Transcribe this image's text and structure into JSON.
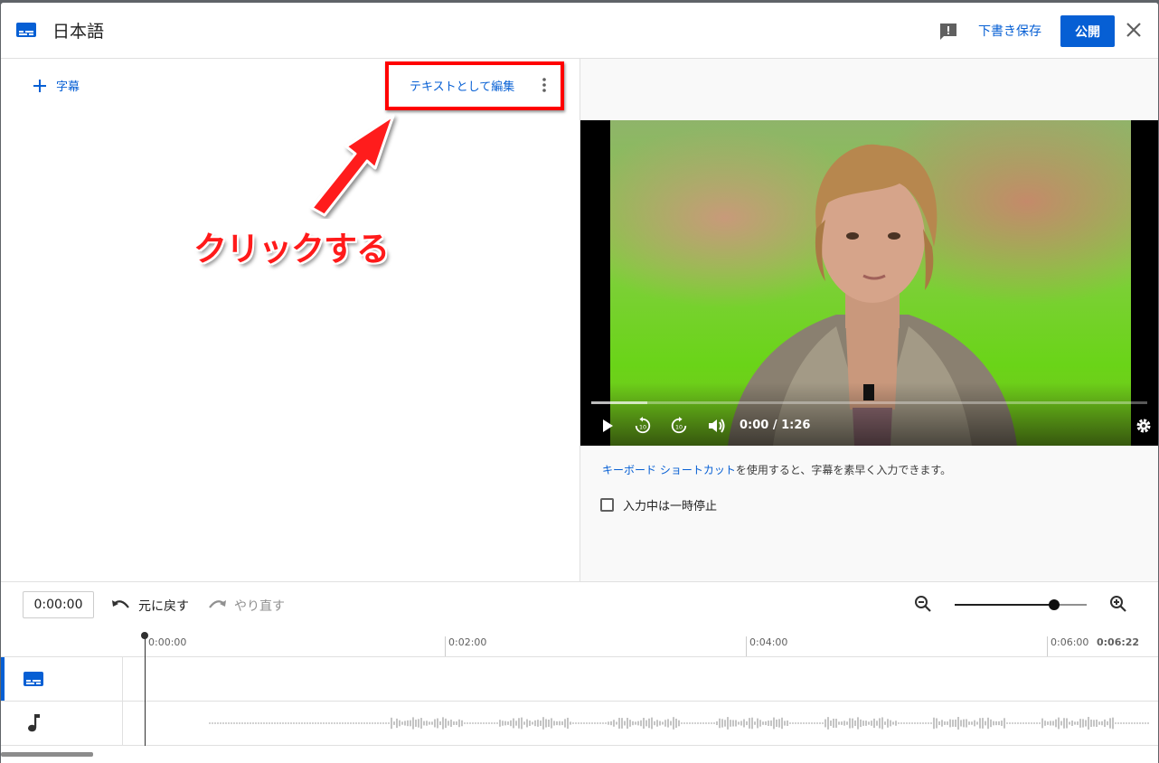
{
  "header": {
    "title": "日本語",
    "draft_label": "下書き保存",
    "publish_label": "公開",
    "icons": [
      "subtitles-icon",
      "feedback-icon",
      "close-icon"
    ]
  },
  "editor": {
    "add_subtitle_label": "字幕",
    "edit_as_text_label": "テキストとして編集",
    "annotation": "クリックする"
  },
  "player": {
    "time": "0:00 / 1:26",
    "progress": 0.1
  },
  "hints": {
    "keyboard_link": "キーボード ショートカット",
    "keyboard_text": "を使用すると、字幕を素早く入力できます。",
    "pause_label": "入力中は一時停止",
    "pause_checked": false
  },
  "timeline": {
    "current_time": "0:00:00",
    "undo_label": "元に戻す",
    "redo_label": "やり直す",
    "zoom_level": 0.75,
    "ticks": [
      "0:00:00",
      "0:02:00",
      "0:04:00",
      "0:06:00"
    ],
    "end_time": "0:06:22"
  },
  "colors": {
    "accent": "#065fd4",
    "annotation_red": "#ff1a1a"
  }
}
